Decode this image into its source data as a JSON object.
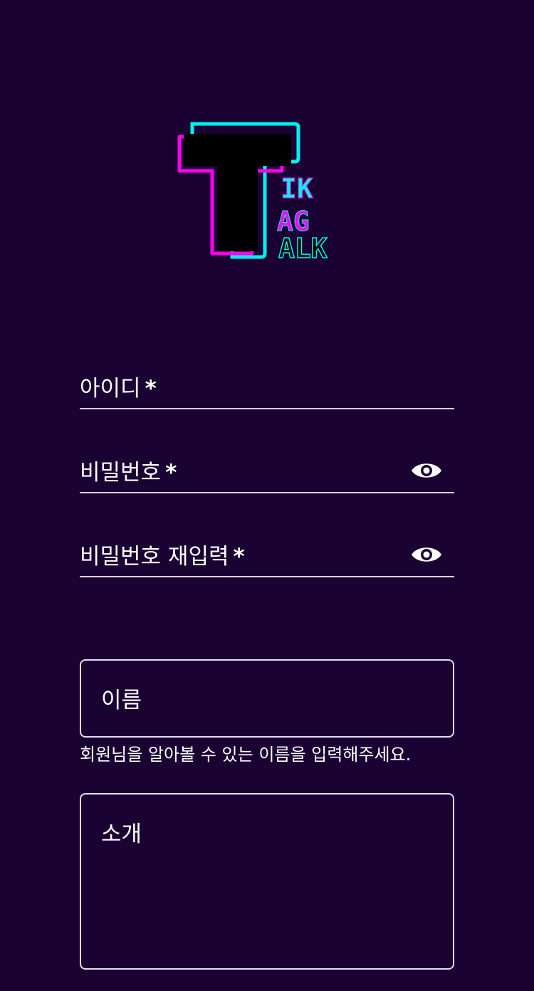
{
  "logo": {
    "letters": {
      "big_t": "T",
      "row1": "IK",
      "row2": "AG",
      "row3": "ALK"
    },
    "colors": {
      "cyan": "#00f0f0",
      "magenta": "#ff00ee",
      "black": "#000000"
    }
  },
  "form": {
    "id_label": "아이디",
    "password_label": "비밀번호",
    "password_confirm_label": "비밀번호 재입력",
    "required_mark": "*",
    "name_placeholder": "이름",
    "name_helper": "회원님을 알아볼 수 있는 이름을 입력해주세요.",
    "intro_placeholder": "소개"
  },
  "icons": {
    "toggle_visibility": "eye-icon"
  },
  "colors": {
    "background": "#1a0333",
    "text": "#ffffff",
    "line": "#d9cfe6"
  }
}
